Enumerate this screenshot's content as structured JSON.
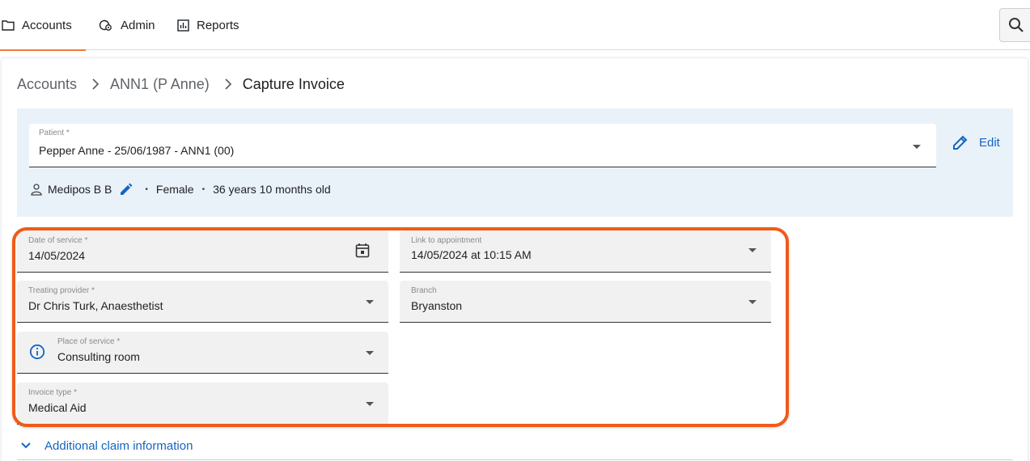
{
  "nav": {
    "items": [
      {
        "label": "Accounts",
        "icon": "folder-icon",
        "active": true
      },
      {
        "label": "Admin",
        "icon": "admin-icon",
        "active": false
      },
      {
        "label": "Reports",
        "icon": "reports-icon",
        "active": false
      }
    ],
    "search_icon": "search-icon",
    "active_color": "#f07a3a"
  },
  "breadcrumb": [
    "Accounts",
    "ANN1 (P Anne)",
    "Capture Invoice"
  ],
  "patient": {
    "label": "Patient *",
    "value": "Pepper Anne - 25/06/1987 - ANN1 (00)",
    "edit_label": "Edit",
    "member": "Medipos B B",
    "gender": "Female",
    "age": "36 years 10 months old",
    "panel_color": "#eaf2f9"
  },
  "form": {
    "date_of_service": {
      "label": "Date of service *",
      "value": "14/05/2024"
    },
    "link_to_appointment": {
      "label": "Link to appointment",
      "value": "14/05/2024 at 10:15 AM"
    },
    "treating_provider": {
      "label": "Treating provider *",
      "value": "Dr Chris Turk, Anaesthetist"
    },
    "branch": {
      "label": "Branch",
      "value": "Bryanston"
    },
    "place_of_service": {
      "label": "Place of service *",
      "value": "Consulting room"
    },
    "invoice_type": {
      "label": "Invoice type *",
      "value": "Medical Aid"
    }
  },
  "additional_claim_label": "Additional claim information",
  "colors": {
    "accent": "#1565c0",
    "highlight": "#f05a1a"
  }
}
